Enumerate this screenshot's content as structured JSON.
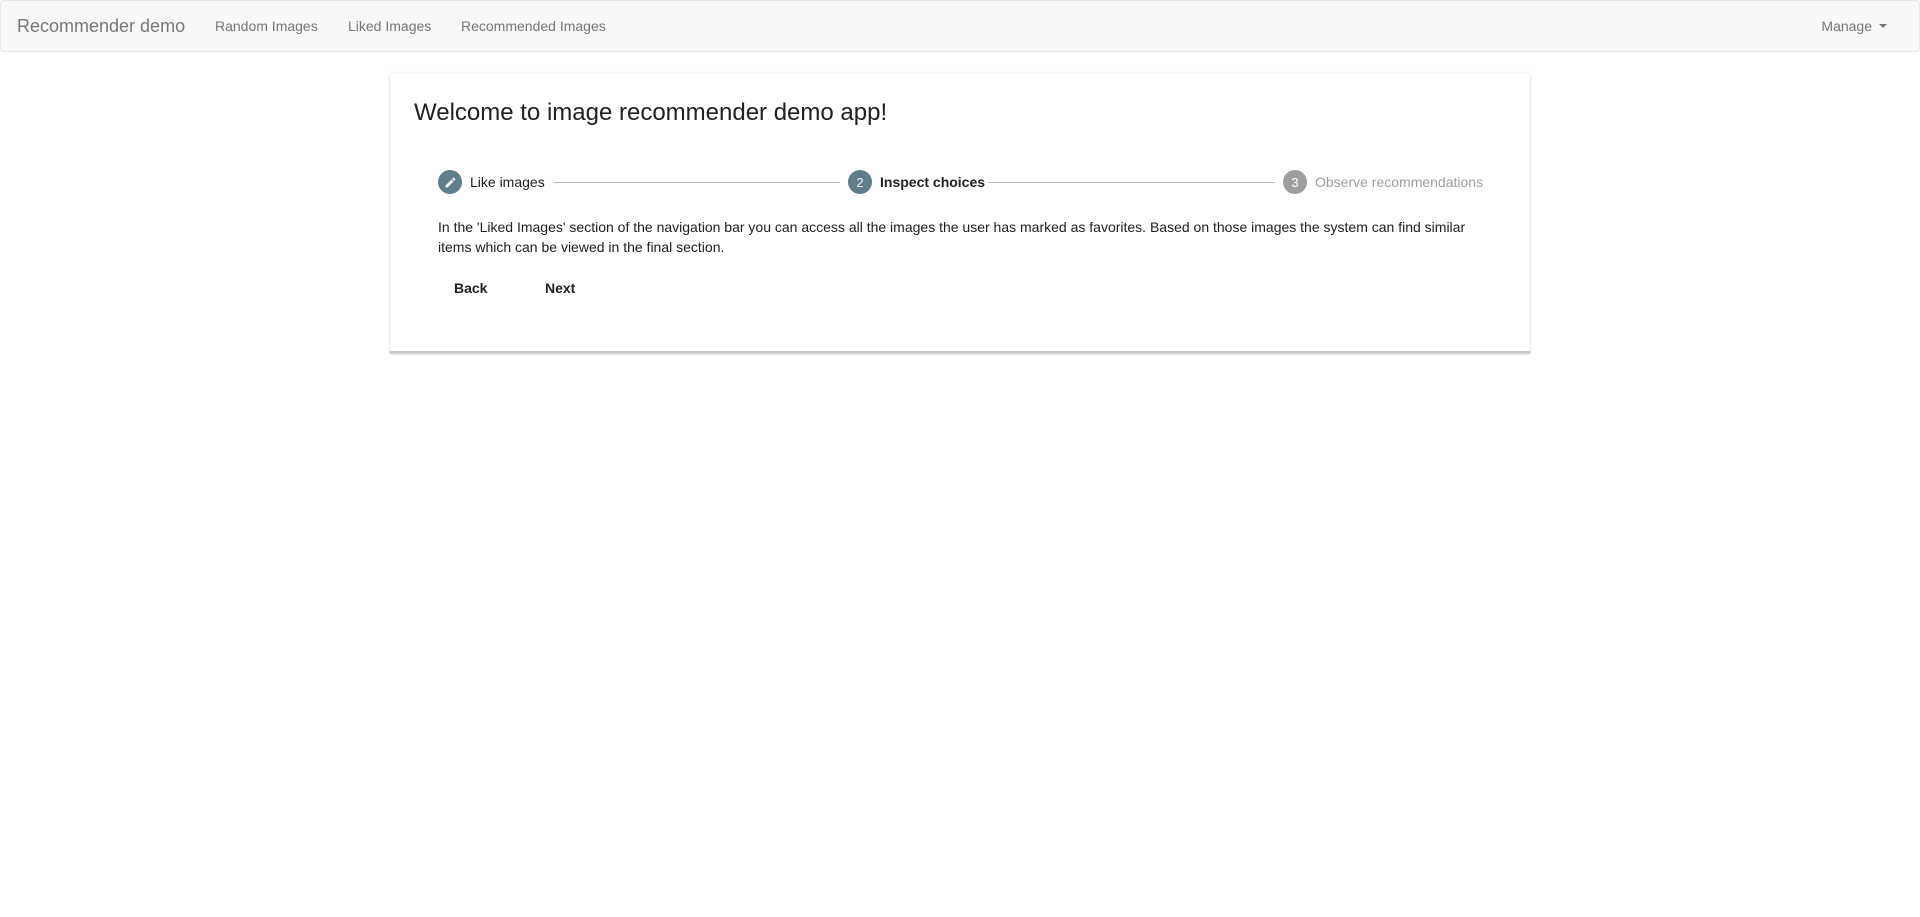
{
  "navbar": {
    "brand": "Recommender demo",
    "links": [
      {
        "label": "Random Images"
      },
      {
        "label": "Liked Images"
      },
      {
        "label": "Recommended Images"
      }
    ],
    "manage_label": "Manage"
  },
  "card": {
    "title": "Welcome to image recommender demo app!",
    "steps": [
      {
        "number": "1",
        "label": "Like images",
        "state": "completed",
        "icon": "pencil-icon"
      },
      {
        "number": "2",
        "label": "Inspect choices",
        "state": "active"
      },
      {
        "number": "3",
        "label": "Observe recommendations",
        "state": "inactive"
      }
    ],
    "step_content": "In the 'Liked Images' section of the navigation bar you can access all the images the user has marked as favorites. Based on those images the system can find similar items which can be viewed in the final section.",
    "back_label": "Back",
    "next_label": "Next"
  },
  "colors": {
    "step_active": "#607d8b",
    "step_inactive": "#9e9e9e",
    "navbar_bg": "#f8f8f8"
  }
}
